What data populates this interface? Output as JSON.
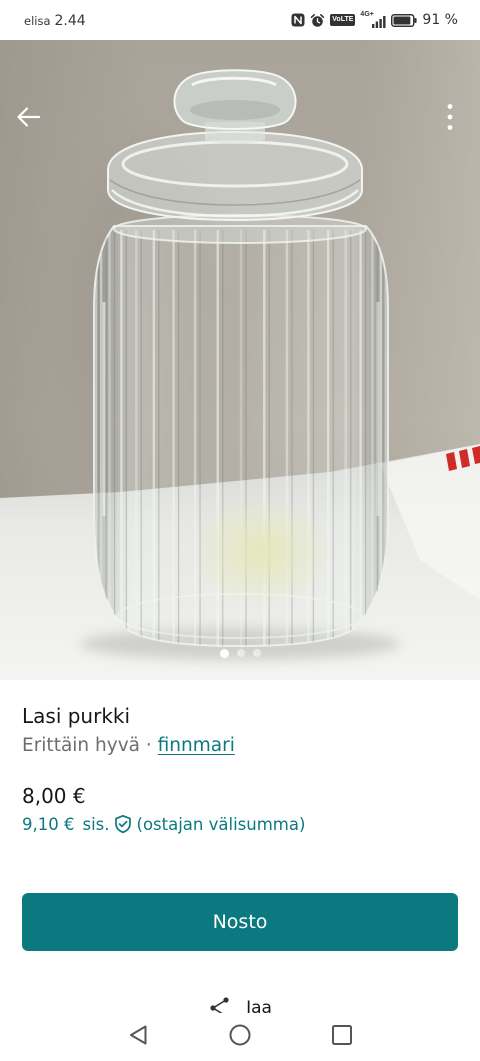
{
  "status_bar": {
    "carrier": "elisa",
    "time": "2.44",
    "volte": "VoLTE",
    "network": "4G+",
    "battery_text": "91 %",
    "battery_level": 0.91,
    "icons": [
      "nfc-icon",
      "alarm-icon",
      "volte-icon",
      "signal-icon",
      "battery-icon"
    ]
  },
  "header": {
    "back_icon": "arrow-left-icon",
    "menu_icon": "more-vertical-icon"
  },
  "gallery": {
    "photo_count": 3,
    "active_index": 0
  },
  "item": {
    "title": "Lasi purkki",
    "condition": "Erittäin hyvä",
    "separator": "·",
    "seller": "finnmari",
    "price": "8,00 €",
    "total_price": "9,10 €",
    "total_suffix": "sis.",
    "total_note": "(ostajan välisumma)",
    "protection_icon": "shield-check-icon"
  },
  "actions": {
    "bump_label": "Nosto",
    "share_label": "Jaa",
    "share_icon": "share-icon"
  },
  "nav_bar": {
    "icons": [
      "back-triangle-icon",
      "home-circle-icon",
      "recents-square-icon"
    ]
  },
  "colors": {
    "accent": "#0a7a80",
    "text": "#171717",
    "muted": "#6e6e6e"
  }
}
